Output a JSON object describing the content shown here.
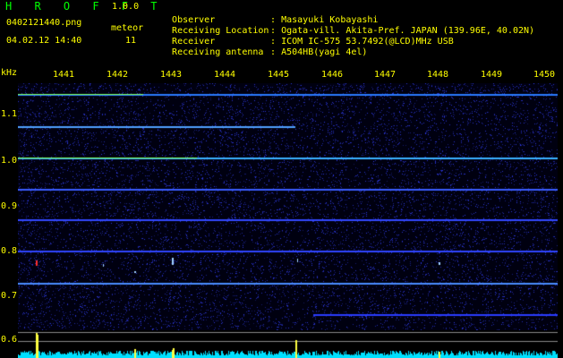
{
  "header": {
    "title": "H R O F F T",
    "version": "1.0.0",
    "filename": "0402121440.png",
    "meteor_label": "meteor",
    "timestamp": "04.02.12 14:40",
    "meteor_count": "11"
  },
  "info": [
    {
      "label": "Observer",
      "value": ": Masayuki Kobayashi"
    },
    {
      "label": "Receiving Location",
      "value": ": Ogata-vill. Akita-Pref. JAPAN (139.96E, 40.02N)"
    },
    {
      "label": "Receiver",
      "value": ": ICOM IC-575 53.7492(@LCD)MHz USB"
    },
    {
      "label": "Receiving antenna",
      "value": ": A504HB(yagi 4el)"
    }
  ],
  "axis": {
    "freq_unit": "kHz",
    "minute_labels": [
      "1441",
      "1442",
      "1443",
      "1444",
      "1445",
      "1446",
      "1447",
      "1448",
      "1449",
      "1450"
    ],
    "freq_labels": [
      "1.1",
      "1.0",
      "0.9",
      "0.8",
      "0.7",
      "0.6"
    ]
  },
  "colors": {
    "background": "#000000",
    "text_yellow": "#ffff00",
    "text_green": "#00ff00",
    "noise_blue": "#3040c0",
    "strip_cyan": "#00e0ff"
  }
}
